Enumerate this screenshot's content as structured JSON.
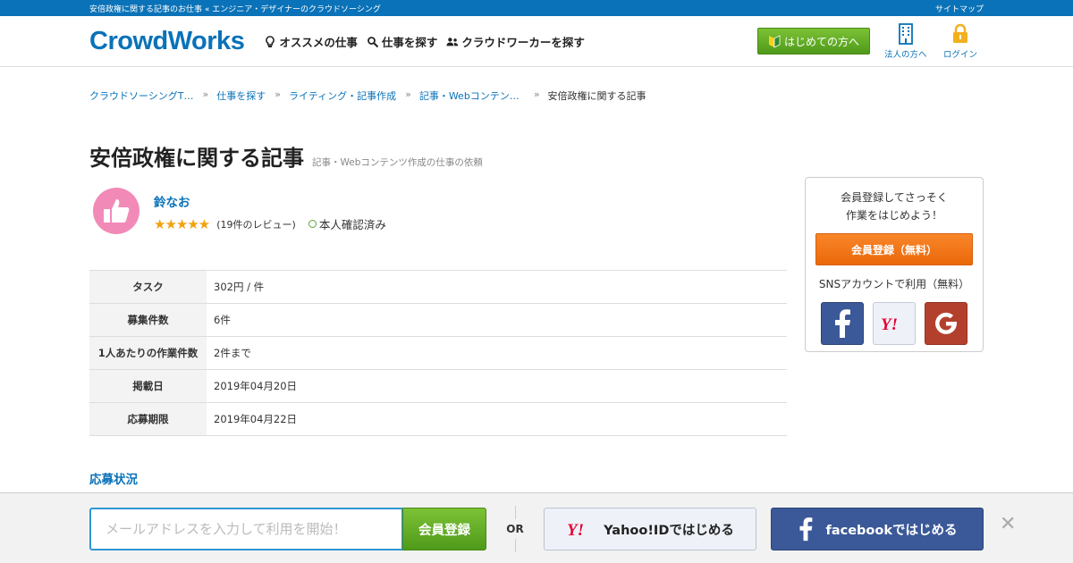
{
  "topbar": {
    "tagline": "安倍政権に関する記事のお仕事 « エンジニア・デザイナーのクラウドソーシング",
    "sitemap": "サイトマップ"
  },
  "header": {
    "logo": "CrowdWorks",
    "nav": [
      {
        "label": "オススメの仕事",
        "icon": "bulb-icon"
      },
      {
        "label": "仕事を探す",
        "icon": "search-icon"
      },
      {
        "label": "クラウドワーカーを探す",
        "icon": "people-icon"
      }
    ],
    "beginner_button": "はじめての方へ",
    "corporate_label": "法人の方へ",
    "login_label": "ログイン"
  },
  "breadcrumb": {
    "sep": "»",
    "items": [
      "クラウドソーシングT…",
      "仕事を探す",
      "ライティング・記事作成",
      "記事・Webコンテン…"
    ],
    "current": "安倍政権に関する記事"
  },
  "job": {
    "title": "安倍政権に関する記事",
    "subtitle": "記事・Webコンテンツ作成の仕事の依頼"
  },
  "client": {
    "name": "鈴なお",
    "stars": "★★★★★",
    "rating": 5,
    "reviews": "(19件のレビュー)",
    "verified": "本人確認済み"
  },
  "details": [
    {
      "key": "タスク",
      "value": "302円 / 件"
    },
    {
      "key": "募集件数",
      "value": "6件"
    },
    {
      "key": "1人あたりの作業件数",
      "value": "2件まで"
    },
    {
      "key": "掲載日",
      "value": "2019年04月20日"
    },
    {
      "key": "応募期限",
      "value": "2019年04月22日"
    }
  ],
  "section": {
    "applications": "応募状況"
  },
  "sidebar": {
    "lead_line1": "会員登録してさっそく",
    "lead_line2": "作業をはじめよう！",
    "signup_button": "会員登録（無料）",
    "sns_label": "SNSアカウントで利用（無料）"
  },
  "bottombar": {
    "email_placeholder": "メールアドレスを入力して利用を開始！",
    "register_button": "会員登録",
    "or": "OR",
    "yahoo_button": "Yahoo!IDではじめる",
    "facebook_button": "facebookではじめる",
    "close": "✕"
  },
  "colors": {
    "brand_blue": "#0a72b8",
    "green": "#5aa628",
    "orange": "#f07a1a",
    "facebook": "#3b5998",
    "google": "#b3402d",
    "avatar_pink": "#f28ab8"
  }
}
